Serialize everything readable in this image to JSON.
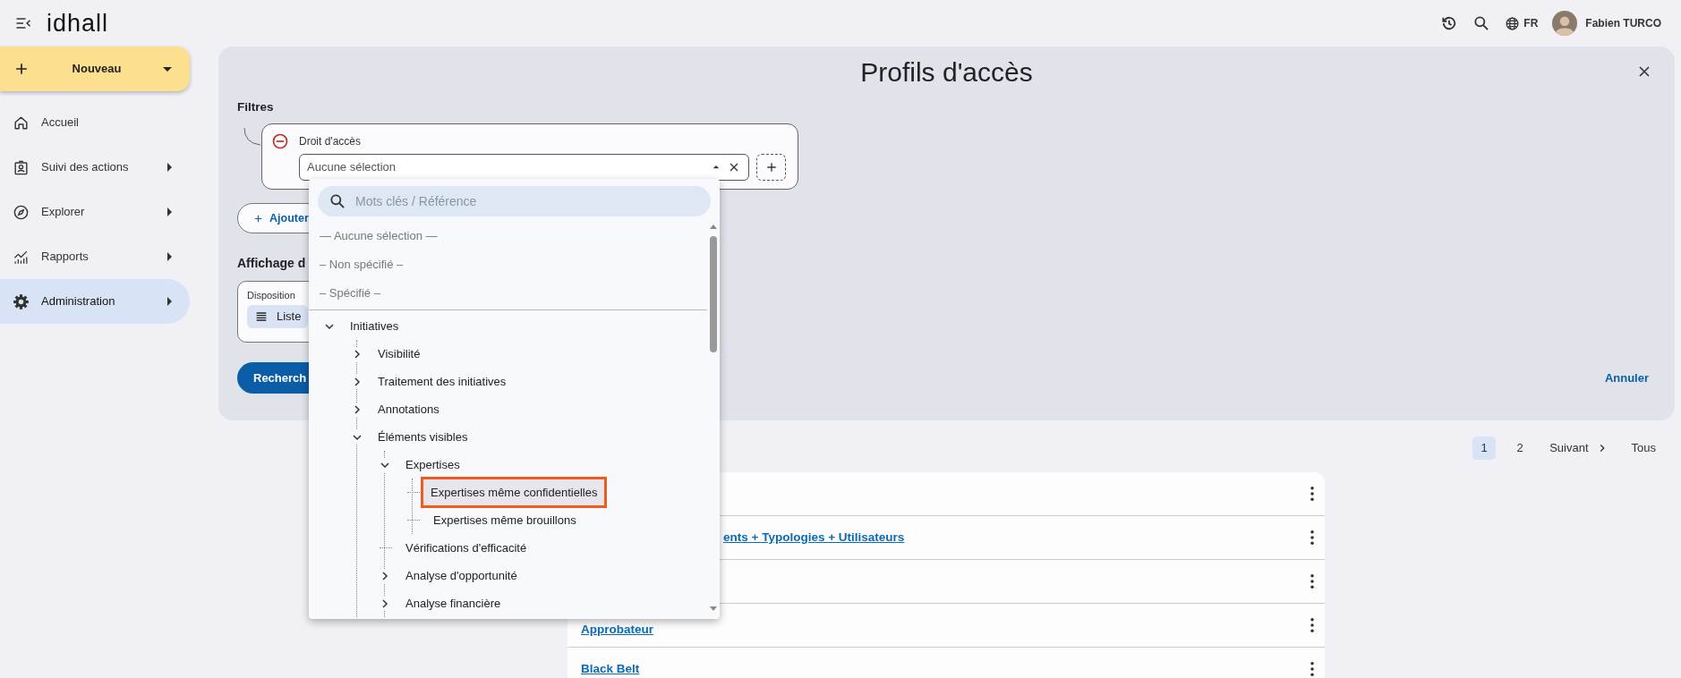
{
  "header": {
    "logo": "idhall",
    "language": "FR",
    "user_name": "Fabien TURCO"
  },
  "sidebar": {
    "new_button": "Nouveau",
    "items": [
      {
        "label": "Accueil",
        "kind": "home",
        "has_submenu": false,
        "selected": false
      },
      {
        "label": "Suivi des actions",
        "kind": "badge",
        "has_submenu": true,
        "selected": false
      },
      {
        "label": "Explorer",
        "kind": "compass",
        "has_submenu": true,
        "selected": false
      },
      {
        "label": "Rapports",
        "kind": "chart",
        "has_submenu": true,
        "selected": false
      },
      {
        "label": "Administration",
        "kind": "gear",
        "has_submenu": true,
        "selected": true
      }
    ]
  },
  "panel": {
    "title": "Profils d'accès",
    "filters_heading": "Filtres",
    "filter": {
      "label": "Droit d'accès",
      "value": "Aucune sélection",
      "open": true
    },
    "add_filter_button": "Ajouter",
    "display_heading": "Affichage d",
    "layout_label": "Disposition",
    "layout_value": "Liste",
    "search_button": "Recherch",
    "cancel_link": "Annuler"
  },
  "dropdown": {
    "placeholder": "Mots clés / Référence",
    "options": [
      "— Aucune sélection —",
      "– Non spécifié –",
      "– Spécifié –"
    ],
    "tree": [
      {
        "label": "Initiatives",
        "kind": "branch",
        "expanded": true,
        "selected": false,
        "children": [
          {
            "label": "Visibilité",
            "kind": "branch",
            "expanded": false,
            "selected": false
          },
          {
            "label": "Traitement des initiatives",
            "kind": "branch",
            "expanded": false,
            "selected": false
          },
          {
            "label": "Annotations",
            "kind": "branch",
            "expanded": false,
            "selected": false
          },
          {
            "label": "Éléments visibles",
            "kind": "branch",
            "expanded": true,
            "selected": false,
            "children": [
              {
                "label": "Expertises",
                "kind": "branch",
                "expanded": true,
                "selected": false,
                "children": [
                  {
                    "label": "Expertises même confidentielles",
                    "kind": "leaf",
                    "selected": true
                  },
                  {
                    "label": "Expertises même brouillons",
                    "kind": "leaf",
                    "selected": false
                  }
                ]
              },
              {
                "label": "Vérifications d'efficacité",
                "kind": "leaf",
                "selected": false
              },
              {
                "label": "Analyse d'opportunité",
                "kind": "branch",
                "expanded": false,
                "selected": false
              },
              {
                "label": "Analyse financière",
                "kind": "branch",
                "expanded": false,
                "selected": false
              }
            ]
          }
        ]
      }
    ]
  },
  "pagination": {
    "pages": [
      {
        "label": "1",
        "selected": true
      },
      {
        "label": "2",
        "selected": false
      }
    ],
    "next": "Suivant",
    "all": "Tous"
  },
  "results": [
    {
      "has_menu": true
    },
    {
      "title": "ents + Typologies + Utilisateurs",
      "has_menu": true
    },
    {
      "has_menu": true
    },
    {
      "title": "Approbateur",
      "has_menu": true
    },
    {
      "title": "Black Belt",
      "has_menu": true
    }
  ]
}
